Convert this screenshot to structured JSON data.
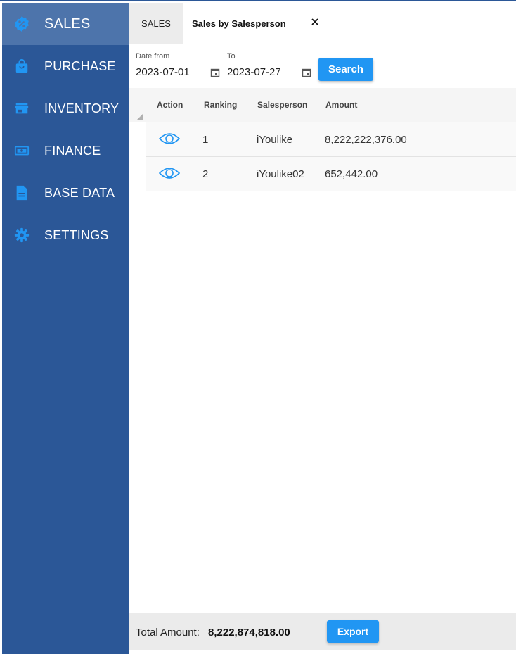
{
  "sidebar": {
    "items": [
      {
        "label": "SALES",
        "icon": "percent-badge-icon",
        "active": true
      },
      {
        "label": "PURCHASE",
        "icon": "shopping-bag-icon"
      },
      {
        "label": "INVENTORY",
        "icon": "store-icon"
      },
      {
        "label": "FINANCE",
        "icon": "banknote-icon"
      },
      {
        "label": "BASE DATA",
        "icon": "document-icon"
      },
      {
        "label": "SETTINGS",
        "icon": "gear-icon"
      }
    ]
  },
  "tabs": {
    "sales_label": "SALES",
    "active_label": "Sales by Salesperson",
    "close_glyph": "✕"
  },
  "filters": {
    "from_label": "Date from",
    "from_value": "2023-07-01",
    "to_label": "To",
    "to_value": "2023-07-27",
    "search_label": "Search"
  },
  "table": {
    "headers": {
      "action": "Action",
      "ranking": "Ranking",
      "salesperson": "Salesperson",
      "amount": "Amount"
    },
    "rows": [
      {
        "ranking": "1",
        "salesperson": "iYoulike",
        "amount": "8,222,222,376.00"
      },
      {
        "ranking": "2",
        "salesperson": "iYoulike02",
        "amount": "652,442.00"
      }
    ]
  },
  "footer": {
    "total_label": "Total Amount:",
    "total_value": "8,222,874,818.00",
    "export_label": "Export"
  },
  "colors": {
    "sidebar": "#2b5797",
    "sidebar_active": "#4d74ab",
    "accent": "#2196f3",
    "icon": "#2196f3"
  }
}
